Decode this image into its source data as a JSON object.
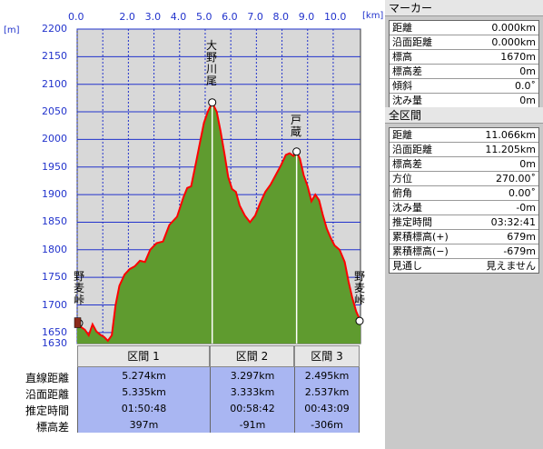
{
  "chart_data": {
    "type": "area",
    "x_ticks": [
      "0.0",
      "2.0",
      "3.0",
      "4.0",
      "5.0",
      "6.0",
      "7.0",
      "8.0",
      "9.0",
      "10.0"
    ],
    "x_unit": "[km]",
    "y_ticks": [
      "2200",
      "2150",
      "2100",
      "2050",
      "2000",
      "1950",
      "1900",
      "1850",
      "1800",
      "1750",
      "1700",
      "1650",
      "1630"
    ],
    "y_unit": "[m]",
    "xlim": [
      0,
      11.066
    ],
    "ylim": [
      1630,
      2200
    ],
    "profile": [
      [
        0.0,
        1667
      ],
      [
        0.15,
        1660
      ],
      [
        0.3,
        1655
      ],
      [
        0.45,
        1645
      ],
      [
        0.6,
        1665
      ],
      [
        0.75,
        1652
      ],
      [
        0.9,
        1646
      ],
      [
        1.05,
        1642
      ],
      [
        1.2,
        1635
      ],
      [
        1.35,
        1645
      ],
      [
        1.5,
        1700
      ],
      [
        1.65,
        1735
      ],
      [
        1.85,
        1755
      ],
      [
        2.05,
        1765
      ],
      [
        2.25,
        1770
      ],
      [
        2.45,
        1780
      ],
      [
        2.65,
        1778
      ],
      [
        2.85,
        1800
      ],
      [
        3.1,
        1812
      ],
      [
        3.35,
        1815
      ],
      [
        3.6,
        1845
      ],
      [
        3.9,
        1860
      ],
      [
        4.15,
        1895
      ],
      [
        4.3,
        1912
      ],
      [
        4.45,
        1915
      ],
      [
        4.65,
        1960
      ],
      [
        4.8,
        1995
      ],
      [
        4.95,
        2030
      ],
      [
        5.1,
        2050
      ],
      [
        5.274,
        2067
      ],
      [
        5.45,
        2050
      ],
      [
        5.6,
        2015
      ],
      [
        5.75,
        1975
      ],
      [
        5.9,
        1932
      ],
      [
        6.05,
        1910
      ],
      [
        6.2,
        1905
      ],
      [
        6.35,
        1880
      ],
      [
        6.55,
        1862
      ],
      [
        6.75,
        1850
      ],
      [
        6.95,
        1862
      ],
      [
        7.15,
        1885
      ],
      [
        7.35,
        1905
      ],
      [
        7.55,
        1918
      ],
      [
        7.75,
        1935
      ],
      [
        7.95,
        1952
      ],
      [
        8.15,
        1972
      ],
      [
        8.3,
        1975
      ],
      [
        8.45,
        1970
      ],
      [
        8.571,
        1978
      ],
      [
        8.7,
        1965
      ],
      [
        8.85,
        1935
      ],
      [
        9.0,
        1915
      ],
      [
        9.15,
        1888
      ],
      [
        9.3,
        1900
      ],
      [
        9.45,
        1890
      ],
      [
        9.6,
        1862
      ],
      [
        9.75,
        1838
      ],
      [
        9.9,
        1822
      ],
      [
        10.05,
        1808
      ],
      [
        10.25,
        1800
      ],
      [
        10.45,
        1778
      ],
      [
        10.6,
        1742
      ],
      [
        10.75,
        1712
      ],
      [
        10.9,
        1688
      ],
      [
        11.066,
        1671
      ]
    ],
    "points": [
      {
        "label": "野麦峠",
        "x": 0.0,
        "y": 1667
      },
      {
        "label": "大野川尾",
        "x": 5.274,
        "y": 2067
      },
      {
        "label": "戸蔵",
        "x": 8.571,
        "y": 1978
      },
      {
        "label": "野麦峠",
        "x": 11.066,
        "y": 1671
      }
    ],
    "colors": {
      "fill": "#5f9b2f",
      "line": "#ff0000",
      "plot_bg": "#d8d8d8",
      "grid": "#2233cc"
    }
  },
  "sections": {
    "row_labels": [
      "直線距離",
      "沿面距離",
      "推定時間",
      "標高差"
    ],
    "items": [
      {
        "name": "区間 1",
        "distance": "5.274km",
        "surface": "5.335km",
        "time": "01:50:48",
        "elevation": "397m"
      },
      {
        "name": "区間 2",
        "distance": "3.297km",
        "surface": "3.333km",
        "time": "00:58:42",
        "elevation": "-91m"
      },
      {
        "name": "区間 3",
        "distance": "2.495km",
        "surface": "2.537km",
        "time": "00:43:09",
        "elevation": "-306m"
      }
    ]
  },
  "marker_panel": {
    "title": "マーカー",
    "rows": [
      {
        "label": "距離",
        "value": "0.000km"
      },
      {
        "label": "沿面距離",
        "value": "0.000km"
      },
      {
        "label": "標高",
        "value": "1670m"
      },
      {
        "label": "標高差",
        "value": "0m"
      },
      {
        "label": "傾斜",
        "value": "0.0˚"
      },
      {
        "label": "沈み量",
        "value": "0m"
      }
    ]
  },
  "all_panel": {
    "title": "全区間",
    "rows": [
      {
        "label": "距離",
        "value": "11.066km"
      },
      {
        "label": "沿面距離",
        "value": "11.205km"
      },
      {
        "label": "標高差",
        "value": "0m"
      },
      {
        "label": "方位",
        "value": "270.00˚"
      },
      {
        "label": "俯角",
        "value": "0.00˚"
      },
      {
        "label": "沈み量",
        "value": "-0m"
      },
      {
        "label": "推定時間",
        "value": "03:32:41"
      },
      {
        "label": "累積標高(+)",
        "value": "679m"
      },
      {
        "label": "累積標高(−)",
        "value": "-679m"
      },
      {
        "label": "見通し",
        "value": "見えません"
      }
    ]
  }
}
